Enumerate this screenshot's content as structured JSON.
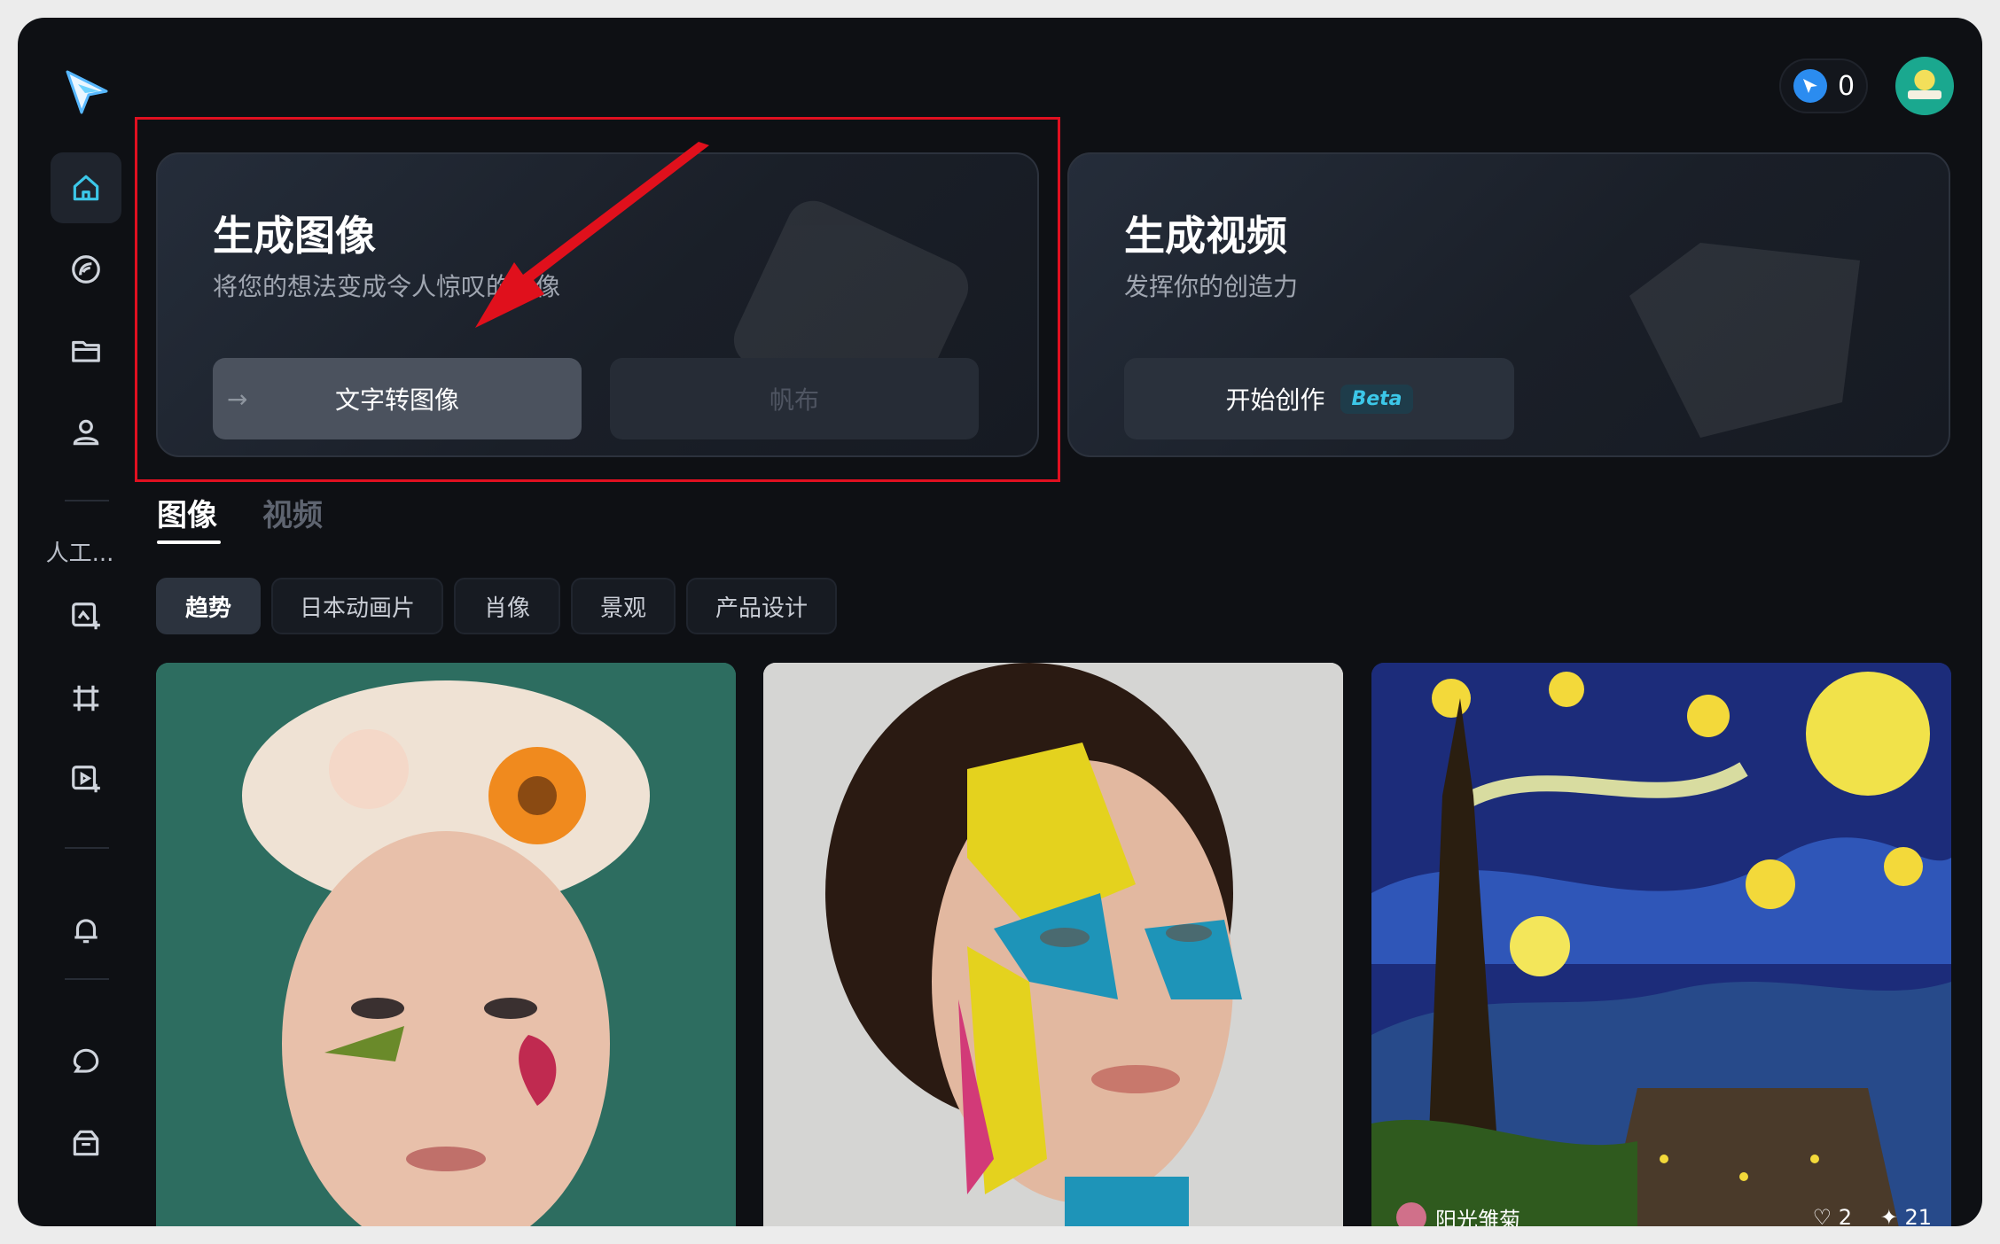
{
  "header": {
    "credits": "0"
  },
  "sidebar": {
    "section_label": "人工..."
  },
  "feature_cards": {
    "image": {
      "title": "生成图像",
      "subtitle": "将您的想法变成令人惊叹的图像",
      "primary_button": "文字转图像",
      "secondary_button": "帆布"
    },
    "video": {
      "title": "生成视频",
      "subtitle": "发挥你的创造力",
      "button": "开始创作",
      "badge": "Beta"
    }
  },
  "tabs": [
    "图像",
    "视频"
  ],
  "filters": [
    "趋势",
    "日本动画片",
    "肖像",
    "景观",
    "产品设计"
  ],
  "gallery": [
    {
      "name": "flower-crown-portrait"
    },
    {
      "name": "geometric-paint-portrait"
    },
    {
      "name": "starry-night-landscape",
      "author": "阳光雏菊",
      "likes": "2",
      "remixes": "21"
    }
  ],
  "colors": {
    "accent": "#2b8cf0",
    "highlight": "#e01020",
    "beta": "#3cc7e8"
  }
}
